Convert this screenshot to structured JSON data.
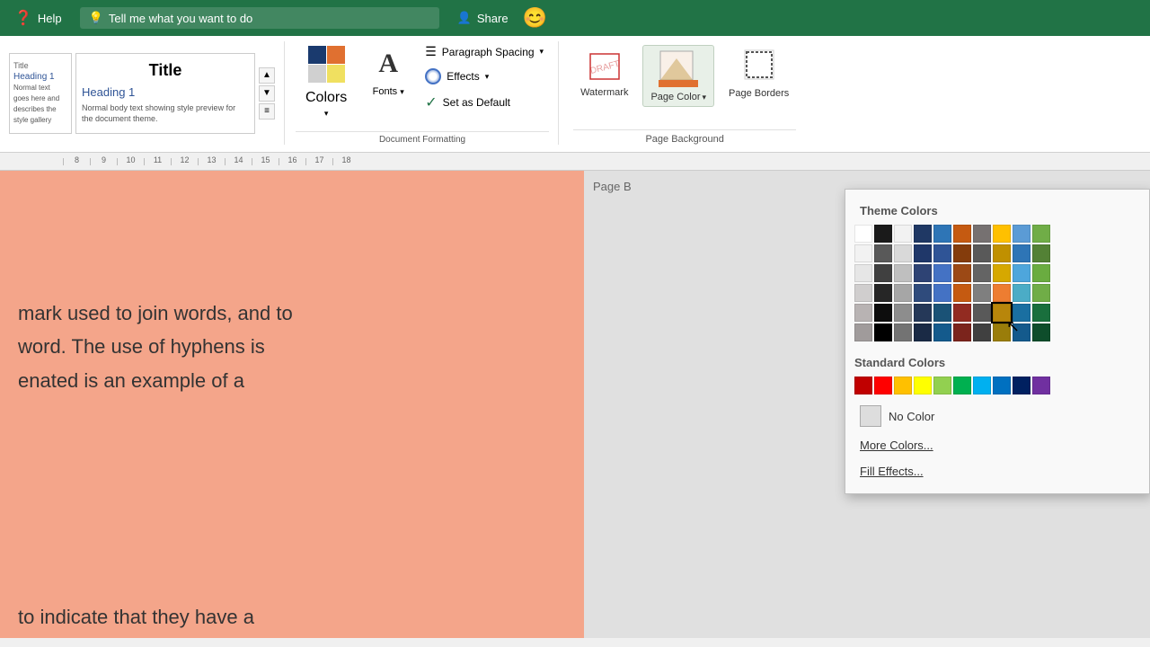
{
  "topbar": {
    "help_label": "Help",
    "tell_me_placeholder": "Tell me what you want to do",
    "share_label": "Share"
  },
  "ribbon": {
    "colors_label": "Colors",
    "fonts_label": "Fonts",
    "paragraph_spacing_label": "Paragraph Spacing",
    "effects_label": "Effects",
    "effects_arrow": "▾",
    "set_default_label": "Set as Default",
    "watermark_label": "Watermark",
    "page_color_label": "Page Color",
    "page_color_arrow": "▾",
    "page_borders_label": "Page Borders",
    "page_background_group": "Page Background",
    "style_gallery_title": "Title",
    "style_heading": "Heading 1"
  },
  "ruler": {
    "marks": [
      "8",
      "9",
      "10",
      "11",
      "12",
      "13",
      "14",
      "15",
      "16",
      "17",
      "18"
    ]
  },
  "document": {
    "text_lines": [
      "mark used to join words, and to",
      "word. The use of hyphens is",
      "enated is an example of a"
    ],
    "bottom_text": "to indicate that they have a",
    "page_bg_label": "Page B"
  },
  "color_picker": {
    "theme_colors_title": "Theme Colors",
    "standard_colors_title": "Standard Colors",
    "no_color_label": "No Color",
    "more_colors_label": "More Colors...",
    "fill_effects_label": "Fill Effects...",
    "theme_color_rows": [
      [
        "#ffffff",
        "#1a1a1a",
        "#f2f2f2",
        "#1f3864",
        "#2e75b6",
        "#c55a11",
        "#767171",
        "#ffc000",
        "#5b9bd5",
        "#70ad47"
      ],
      [
        "#f2f2f2",
        "#595959",
        "#d9d9d9",
        "#1f3769",
        "#2f5496",
        "#843c0c",
        "#595959",
        "#c09000",
        "#2e75b6",
        "#538135"
      ],
      [
        "#e6e6e6",
        "#404040",
        "#bfbfbf",
        "#2e4374",
        "#4472c4",
        "#9c4915",
        "#646464",
        "#d6a800",
        "#4ea6dc",
        "#6aac40"
      ],
      [
        "#d0cece",
        "#262626",
        "#a6a6a6",
        "#2f4b7c",
        "#4472c4",
        "#c55a11",
        "#7f7f7f",
        "#ed7d31",
        "#4bacc6",
        "#70ad47"
      ],
      [
        "#b8b3b3",
        "#0d0d0d",
        "#8d8d8d",
        "#253858",
        "#1a5276",
        "#922b21",
        "#595959",
        "#b8860b",
        "#1a6fa1",
        "#196f3d"
      ],
      [
        "#a09b9b",
        "#000000",
        "#737373",
        "#1a2a45",
        "#145a8c",
        "#7b241c",
        "#404040",
        "#9a7d0a",
        "#145a8c",
        "#0e4d2b"
      ]
    ],
    "standard_colors": [
      "#c00000",
      "#ff0000",
      "#ffc000",
      "#ffff00",
      "#92d050",
      "#00b050",
      "#00b0f0",
      "#0070c0",
      "#002060",
      "#7030a0"
    ],
    "hovered_row": 4,
    "hovered_col": 7
  }
}
